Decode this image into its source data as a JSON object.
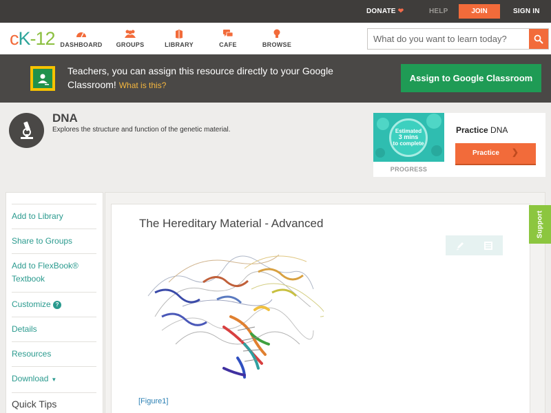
{
  "topbar": {
    "donate": "DONATE",
    "help": "HELP",
    "join": "JOIN",
    "signin": "SIGN IN"
  },
  "nav": {
    "logo": {
      "a": "c",
      "b": "K",
      "c": "-12"
    },
    "items": [
      {
        "label": "DASHBOARD",
        "icon": "dashboard-icon"
      },
      {
        "label": "GROUPS",
        "icon": "groups-icon"
      },
      {
        "label": "LIBRARY",
        "icon": "library-icon"
      },
      {
        "label": "CAFE",
        "icon": "cafe-icon"
      },
      {
        "label": "BROWSE",
        "icon": "browse-icon"
      }
    ],
    "search_placeholder": "What do you want to learn today?"
  },
  "banner": {
    "text": "Teachers, you can assign this resource directly to your Google Classroom!",
    "link": "What is this?",
    "button": "Assign to Google Classroom"
  },
  "concept": {
    "title": "DNA",
    "description": "Explores the structure and function of the genetic material."
  },
  "practice": {
    "estimated_line1": "Estimated",
    "estimated_line2": "3 mins",
    "estimated_line3": "to complete",
    "progress_label": "PROGRESS",
    "title_bold": "Practice",
    "title_rest": "DNA",
    "button": "Practice"
  },
  "sidebar": {
    "items": [
      {
        "label": "Add to Library"
      },
      {
        "label": "Share to Groups"
      },
      {
        "label": "Add to FlexBook®",
        "label2": "Textbook"
      },
      {
        "label": "Customize"
      },
      {
        "label": "Details"
      },
      {
        "label": "Resources"
      },
      {
        "label": "Download"
      }
    ],
    "quick_tips": "Quick Tips"
  },
  "lesson": {
    "title": "The Hereditary Material - Advanced",
    "figure_caption": "[Figure1]"
  },
  "support": "Support",
  "colors": {
    "brand_orange": "#f26b3a",
    "teal": "#2a9a8e",
    "google_green": "#1f9b55",
    "support_green": "#8cc63f"
  }
}
